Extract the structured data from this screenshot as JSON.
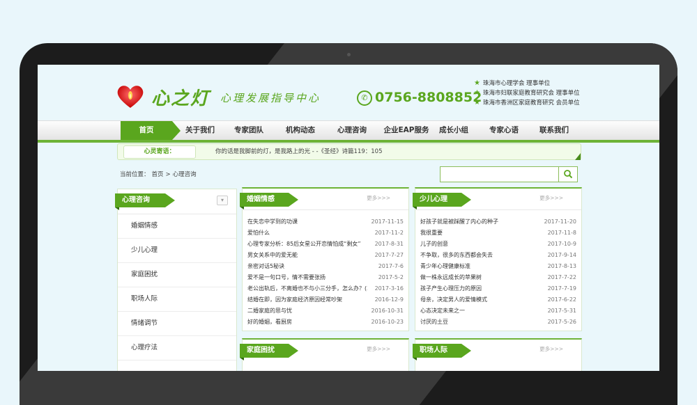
{
  "header": {
    "brand": "心之灯",
    "subtitle": "心理发展指导中心",
    "phone": "0756-8808852",
    "qualifications": [
      "珠海市心理学会 理事单位",
      "珠海市妇联家庭教育研究会 理事单位",
      "珠海市香洲区家庭教育研究 会员单位"
    ]
  },
  "nav": [
    "首页",
    "关于我们",
    "专家团队",
    "机构动态",
    "心理咨询",
    "企业EAP服务",
    "成长小组",
    "专家心语",
    "联系我们"
  ],
  "tip": {
    "label": "心灵寄语：",
    "text": "你的话是我脚前的灯，是我路上的光 - -《圣经》诗篇119：105"
  },
  "breadcrumb": {
    "prefix": "当前位置：",
    "home": "首页",
    "sep": ">",
    "current": "心理咨询"
  },
  "search": {
    "placeholder": ""
  },
  "sidebar": {
    "title": "心理咨询",
    "collapse_icon": "▾",
    "items": [
      "婚姻情感",
      "少儿心理",
      "家庭困扰",
      "职场人际",
      "情绪调节",
      "心理疗法"
    ]
  },
  "more_label": "更多>>>",
  "panels": [
    {
      "title": "婚姻情感",
      "rows": [
        {
          "title": "在失恋中学到的功课",
          "date": "2017-11-15"
        },
        {
          "title": "爱怕什么",
          "date": "2017-11-2"
        },
        {
          "title": "心理专家分析：85后女星公开恋情怕成“剩女”",
          "date": "2017-8-31"
        },
        {
          "title": "男女关系中的爱无能",
          "date": "2017-7-27"
        },
        {
          "title": "亲密对话5秘诀",
          "date": "2017-7-6"
        },
        {
          "title": "爱不是一句口号，情不需要张扬",
          "date": "2017-5-2"
        },
        {
          "title": "老公出轨后，不离婚也不与小三分手，怎么办？(2",
          "date": "2017-3-16"
        },
        {
          "title": "结婚在即，因为家庭经济原因经常吵架",
          "date": "2016-12-9"
        },
        {
          "title": "二婚家庭的思与忧",
          "date": "2016-10-31"
        },
        {
          "title": "好的婚姻，看厨房",
          "date": "2016-10-23"
        }
      ]
    },
    {
      "title": "少儿心理",
      "rows": [
        {
          "title": "好孩子就是被踩醒了内心的种子",
          "date": "2017-11-20"
        },
        {
          "title": "我很重要",
          "date": "2017-11-8"
        },
        {
          "title": "儿子的创意",
          "date": "2017-10-9"
        },
        {
          "title": "不争取，很多的东西都会失去",
          "date": "2017-9-14"
        },
        {
          "title": "青少年心理健康标准",
          "date": "2017-8-13"
        },
        {
          "title": "做一株永远成长的苹果树",
          "date": "2017-7-22"
        },
        {
          "title": "孩子产生心理压力的原因",
          "date": "2017-7-19"
        },
        {
          "title": "母亲，决定男人的爱情模式",
          "date": "2017-6-22"
        },
        {
          "title": "心态决定未来之一",
          "date": "2017-5-31"
        },
        {
          "title": "讨厌的土豆",
          "date": "2017-5-26"
        }
      ]
    },
    {
      "title": "家庭困扰",
      "rows": []
    },
    {
      "title": "职场人际",
      "rows": []
    }
  ]
}
